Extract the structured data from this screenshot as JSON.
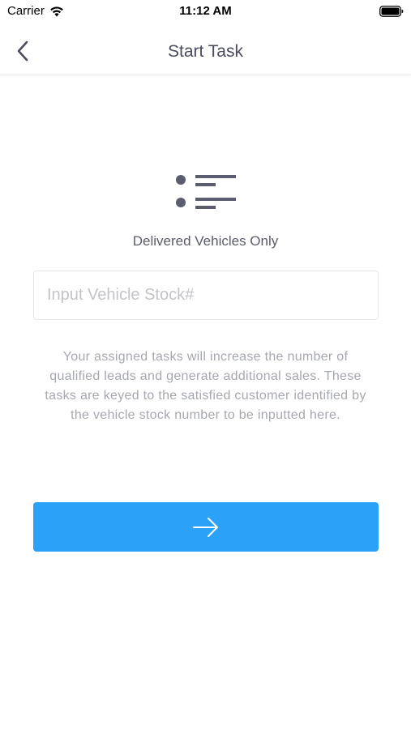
{
  "status_bar": {
    "carrier": "Carrier",
    "time": "11:12 AM",
    "wifi_icon": "wifi-icon",
    "battery_icon": "battery-full-icon"
  },
  "nav": {
    "back_icon": "chevron-left-icon",
    "title": "Start Task"
  },
  "main": {
    "icon": "list-icon",
    "subtitle": "Delivered Vehicles Only",
    "stock_input": {
      "value": "",
      "placeholder": "Input Vehicle Stock#"
    },
    "description": "Your assigned tasks will increase the number of qualified leads and generate additional sales. These tasks are keyed to the satisfied customer identified by the vehicle stock number to be inputted here.",
    "next_button_icon": "arrow-right-icon"
  },
  "colors": {
    "accent": "#2ba1f7",
    "title_text": "#4a4c5e",
    "icon": "#5b5d6e",
    "muted_text": "#a6a8b0",
    "placeholder": "#c3c4c9"
  }
}
